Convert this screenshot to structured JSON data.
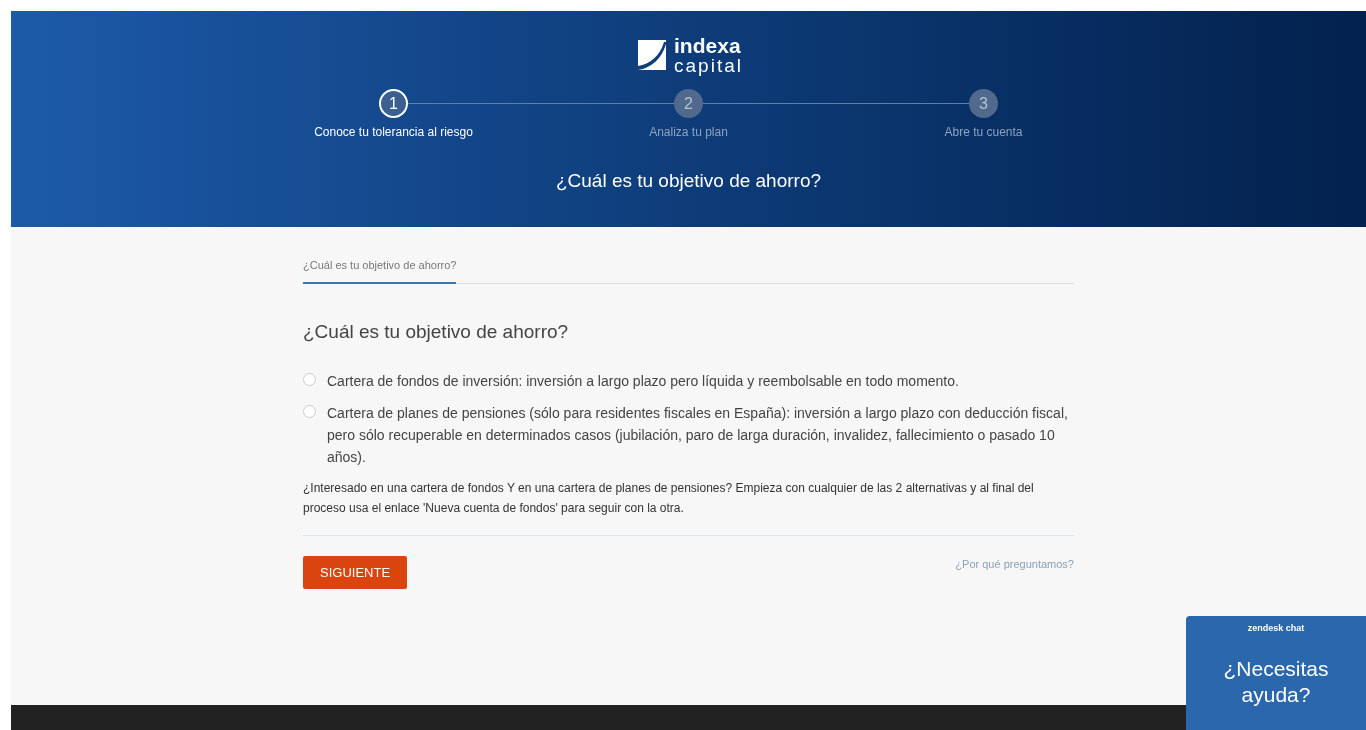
{
  "logo": {
    "line_1": "indexa",
    "line_2": "capital"
  },
  "steps": [
    {
      "number": "1",
      "label": "Conoce tu tolerancia al riesgo",
      "selected": true
    },
    {
      "number": "2",
      "label": "Analiza tu plan",
      "selected": false
    },
    {
      "number": "3",
      "label": "Abre tu cuenta",
      "selected": false
    }
  ],
  "header_title": "¿Cuál es tu objetivo de ahorro?",
  "tabs": [
    {
      "label": "¿Cuál es tu objetivo de ahorro?",
      "selected": true
    }
  ],
  "question": "¿Cuál es tu objetivo de ahorro?",
  "options": [
    {
      "label": "Cartera de fondos de inversión: inversión a largo plazo pero líquida y reembolsable en todo momento.",
      "selected": false
    },
    {
      "label": "Cartera de planes de pensiones (sólo para residentes fiscales en España): inversión a largo plazo con deducción fiscal, pero sólo recuperable en determinados casos (jubilación, paro de larga duración, invalidez, fallecimiento o pasado 10 años).",
      "selected": false
    }
  ],
  "note": "¿Interesado en una cartera de fondos Y en una cartera de planes de pensiones? Empieza con cualquier de las 2 alternativas y al final del proceso usa el enlace 'Nueva cuenta de fondos' para seguir con la otra.",
  "next_button": "SIGUIENTE",
  "why_link": "¿Por qué preguntamos?",
  "chat": {
    "brand": "zendesk chat",
    "text": "¿Necesitas ayuda?"
  }
}
